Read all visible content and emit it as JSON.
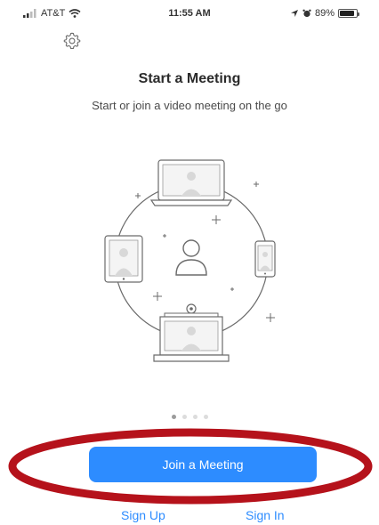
{
  "status_bar": {
    "carrier": "AT&T",
    "time": "11:55 AM",
    "battery_percent": "89%",
    "battery_level": 0.89
  },
  "header": {
    "settings_icon": "gear-icon"
  },
  "main": {
    "title": "Start a Meeting",
    "subtitle": "Start or join a video meeting on the go"
  },
  "pager": {
    "count": 4,
    "active_index": 0
  },
  "actions": {
    "join_label": "Join a Meeting",
    "sign_up_label": "Sign Up",
    "sign_in_label": "Sign In"
  },
  "colors": {
    "accent": "#2d8cff",
    "annotation": "#b5121b",
    "illustration_stroke": "#6b6b6b"
  }
}
